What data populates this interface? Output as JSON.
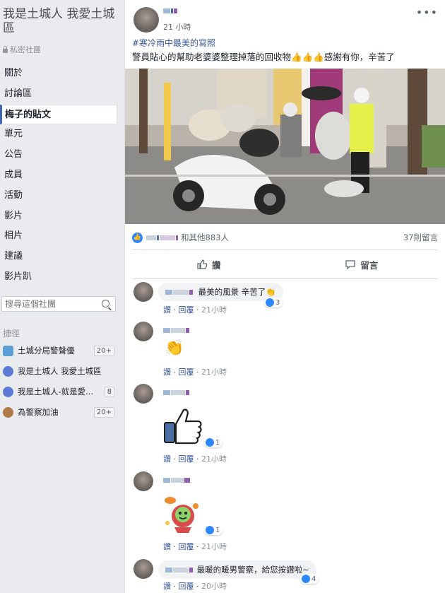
{
  "sidebar": {
    "group_title": "我是土城人 我愛土城區",
    "privacy": "私密社團",
    "nav": [
      "關於",
      "討論區",
      "梅子的貼文",
      "單元",
      "公告",
      "成員",
      "活動",
      "影片",
      "相片",
      "建議",
      "影片趴"
    ],
    "active_index": 2,
    "search_placeholder": "搜尋這個社團",
    "shortcuts_title": "捷徑",
    "shortcuts": [
      {
        "label": "土城分局警聲優",
        "badge": "20+",
        "color": "#5aa0d6"
      },
      {
        "label": "我是土城人 我愛土城區",
        "badge": "",
        "color": "#5b7bd5"
      },
      {
        "label": "我是土城人-就是愛...",
        "badge": "8",
        "color": "#5b7bd5"
      },
      {
        "label": "為警察加油",
        "badge": "20+",
        "color": "#b07a48"
      }
    ]
  },
  "post": {
    "time": "21 小時",
    "hashtag": "#寒冷雨中最美的寫照",
    "text": "警員貼心的幫助老婆婆整理掉落的回收物👍👍👍感謝有你，辛苦了",
    "reactions_text": "和其他883人",
    "comments_count": "37則留言",
    "like_label": "讚",
    "comment_label": "留言"
  },
  "comments": [
    {
      "text": "最美的風景 辛苦了👏",
      "reactions": "3",
      "time": "21小時"
    },
    {
      "text": "👏",
      "reactions": "",
      "time": "21小時"
    },
    {
      "text": "👍",
      "reactions": "1",
      "time": "21小時"
    },
    {
      "text": "sticker",
      "reactions": "1",
      "time": "21小時"
    },
    {
      "text": "最暖的暖男警察，給您按讚啦~",
      "reactions": "4",
      "time": "20小時"
    }
  ],
  "comment_like": "讚",
  "comment_reply": "回覆"
}
